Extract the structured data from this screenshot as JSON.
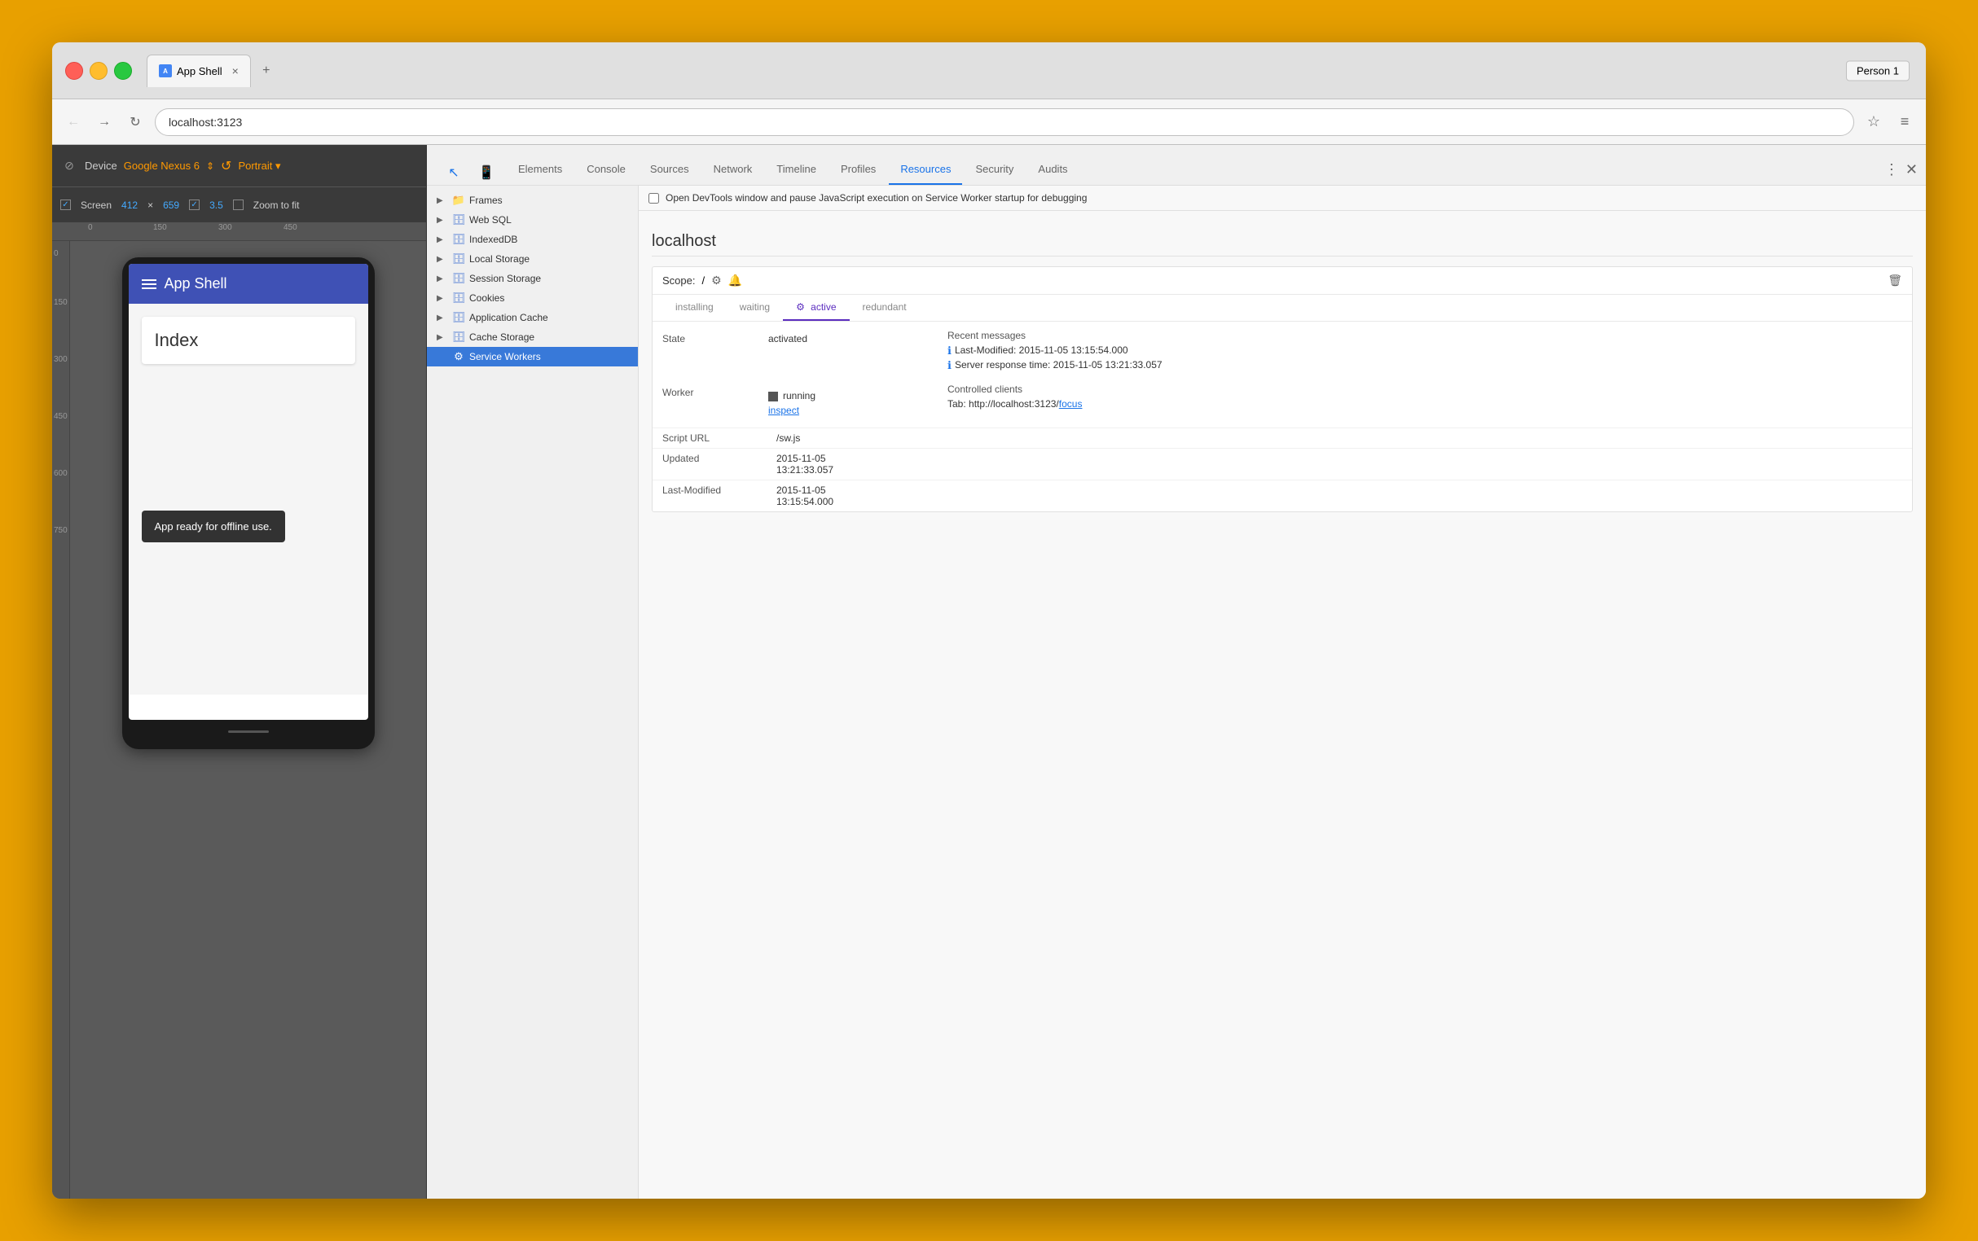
{
  "window": {
    "background_color": "#e8a000"
  },
  "browser": {
    "tab_title": "App Shell",
    "tab_close": "×",
    "tab_new": "+",
    "person_button": "Person 1",
    "address": "localhost:3123",
    "back_icon": "←",
    "forward_icon": "→",
    "refresh_icon": "↻",
    "star_icon": "☆",
    "menu_icon": "≡"
  },
  "device_emulator": {
    "device_icon": "🚫",
    "device_label": "Device",
    "device_name": "Google Nexus 6",
    "arrows_icon": "⇕",
    "rotate_icon": "↺",
    "portrait_label": "Portrait ▾",
    "screen_label": "Screen",
    "screen_width": "412",
    "screen_x": "×",
    "screen_height": "659",
    "zoom_label": "3.5",
    "zoom_to_fit": "Zoom to fit",
    "ruler_marks_h": [
      "0",
      "150",
      "300",
      "450"
    ],
    "ruler_marks_v": [
      "0",
      "150",
      "300",
      "450",
      "600",
      "750"
    ]
  },
  "app_shell": {
    "menu_label": "App Shell",
    "index_title": "Index",
    "snackbar": "App ready for offline use."
  },
  "devtools": {
    "tab_icons": [
      "cursor",
      "phone"
    ],
    "tabs": [
      {
        "label": "Elements",
        "active": false
      },
      {
        "label": "Console",
        "active": false
      },
      {
        "label": "Sources",
        "active": false
      },
      {
        "label": "Network",
        "active": false
      },
      {
        "label": "Timeline",
        "active": false
      },
      {
        "label": "Profiles",
        "active": false
      },
      {
        "label": "Resources",
        "active": true
      },
      {
        "label": "Security",
        "active": false
      },
      {
        "label": "Audits",
        "active": false
      }
    ],
    "warning_text": "Open DevTools window and pause JavaScript execution on Service Worker startup for debugging",
    "resources_tree": {
      "items": [
        {
          "label": "Frames",
          "type": "folder",
          "expanded": false,
          "indent": 0
        },
        {
          "label": "Web SQL",
          "type": "db",
          "expanded": false,
          "indent": 0
        },
        {
          "label": "IndexedDB",
          "type": "db",
          "expanded": false,
          "indent": 0
        },
        {
          "label": "Local Storage",
          "type": "db",
          "expanded": false,
          "indent": 0
        },
        {
          "label": "Session Storage",
          "type": "db",
          "expanded": false,
          "indent": 0
        },
        {
          "label": "Cookies",
          "type": "db",
          "expanded": false,
          "indent": 0
        },
        {
          "label": "Application Cache",
          "type": "db",
          "expanded": false,
          "indent": 0
        },
        {
          "label": "Cache Storage",
          "type": "db",
          "expanded": false,
          "indent": 0
        },
        {
          "label": "Service Workers",
          "type": "sw",
          "expanded": false,
          "indent": 0,
          "selected": true
        }
      ]
    },
    "service_worker": {
      "host": "localhost",
      "scope_label": "Scope:",
      "scope_value": "/",
      "status_tabs": [
        "installing",
        "waiting",
        "active",
        "redundant"
      ],
      "active_tab": "active",
      "state_label": "State",
      "state_value": "activated",
      "worker_label": "Worker",
      "worker_status": "running",
      "worker_inspect": "inspect",
      "recent_messages_label": "Recent messages",
      "messages": [
        "Last-Modified: 2015-11-05 13:15:54.000",
        "Server response time: 2015-11-05 13:21:33.057"
      ],
      "controlled_clients_label": "Controlled clients",
      "client_tab_prefix": "Tab: http://localhost:3123/",
      "client_focus": "focus",
      "script_url_label": "Script URL",
      "script_url_value": "/sw.js",
      "updated_label": "Updated",
      "updated_value": "2015-11-05\n13:21:33.057",
      "updated_value_1": "2015-11-05",
      "updated_value_2": "13:21:33.057",
      "last_modified_label": "Last-Modified",
      "last_modified_value_1": "2015-11-05",
      "last_modified_value_2": "13:15:54.000"
    }
  }
}
